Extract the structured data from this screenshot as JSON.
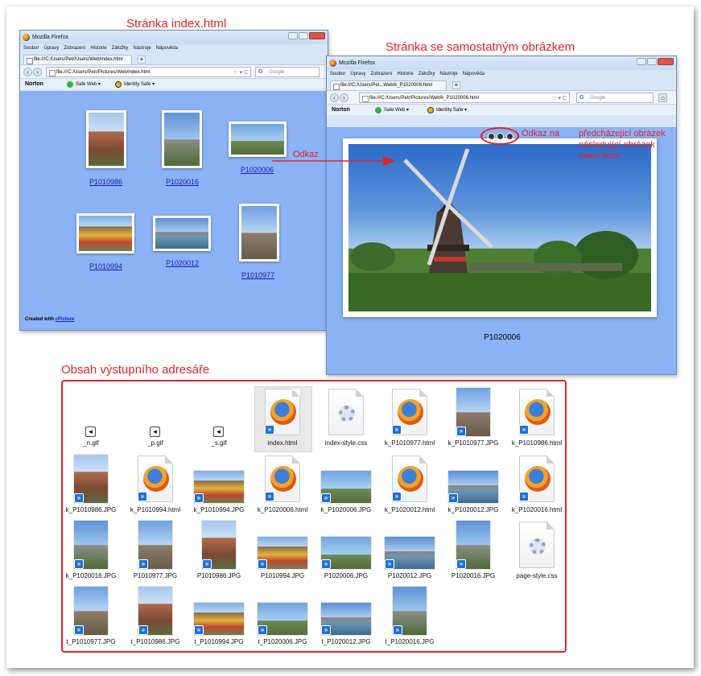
{
  "captions": {
    "index_page": "Stránka index.html",
    "single_page": "Stránka se samostatným obrázkem",
    "output_dir": "Obsah výstupního adresáře",
    "link": "Odkaz",
    "links_to": "Odkaz na",
    "link_targets": [
      "předcházející obrázek",
      "následující obrázek",
      "index.html"
    ]
  },
  "browser": {
    "title": "Mozilla Firefox",
    "menu": [
      "Soubor",
      "Úpravy",
      "Zobrazení",
      "Historie",
      "Záložky",
      "Nástroje",
      "Nápověda"
    ],
    "search_placeholder": "Google",
    "norton": "Norton",
    "safe_web": "Safe Web",
    "identity_safe": "Identity Safe"
  },
  "window1": {
    "tab_title": "file:///C:/Users/Petr/Users/Web/index.html",
    "url": "file:///C:/Users/Petr/Pictures/Web/index.html",
    "thumbs": [
      "P1010986",
      "P1020016",
      "P1020006",
      "P1010994",
      "P1020012",
      "P1010977"
    ],
    "footer_prefix": "Created with",
    "footer_link": "cPicture"
  },
  "window2": {
    "tab_title": "file:///C:/Users/Pet...Web/k_P1020006.html",
    "url": "file:///C:/Users/Petr/Pictures/Web/k_P1020006.html",
    "photo_caption": "P1020006"
  },
  "files": [
    {
      "name": "_n.gif",
      "kind": "gif",
      "glyph": "◂"
    },
    {
      "name": "_p.gif",
      "kind": "gif",
      "glyph": "◂"
    },
    {
      "name": "_s.gif",
      "kind": "gif",
      "glyph": "◂"
    },
    {
      "name": "index.html",
      "kind": "html",
      "selected": true
    },
    {
      "name": "index-style.css",
      "kind": "css"
    },
    {
      "name": "k_P1010977.html",
      "kind": "html"
    },
    {
      "name": "k_P1010977.JPG",
      "kind": "photo",
      "scene": "church",
      "orient": "p"
    },
    {
      "name": "k_P1010986.html",
      "kind": "html"
    },
    {
      "name": "k_P1010986.JPG",
      "kind": "photo",
      "scene": "brick",
      "orient": "p"
    },
    {
      "name": "k_P1010994.html",
      "kind": "html"
    },
    {
      "name": "k_P1010994.JPG",
      "kind": "photo",
      "scene": "cart",
      "orient": "l"
    },
    {
      "name": "k_P1020006.html",
      "kind": "html"
    },
    {
      "name": "k_P1020006.JPG",
      "kind": "photo",
      "scene": "sky",
      "orient": "l"
    },
    {
      "name": "k_P1020012.html",
      "kind": "html"
    },
    {
      "name": "k_P1020012.JPG",
      "kind": "photo",
      "scene": "canal",
      "orient": "l"
    },
    {
      "name": "k_P1020016.html",
      "kind": "html"
    },
    {
      "name": "k_P1020016.JPG",
      "kind": "photo",
      "scene": "sky2",
      "orient": "p"
    },
    {
      "name": "P1010977.JPG",
      "kind": "photo",
      "scene": "church",
      "orient": "p"
    },
    {
      "name": "P1010986.JPG",
      "kind": "photo",
      "scene": "brick",
      "orient": "p"
    },
    {
      "name": "P1010994.JPG",
      "kind": "photo",
      "scene": "cart",
      "orient": "l"
    },
    {
      "name": "P1020006.JPG",
      "kind": "photo",
      "scene": "sky",
      "orient": "l"
    },
    {
      "name": "P1020012.JPG",
      "kind": "photo",
      "scene": "canal",
      "orient": "l"
    },
    {
      "name": "P1020016.JPG",
      "kind": "photo",
      "scene": "sky2",
      "orient": "p"
    },
    {
      "name": "page-style.css",
      "kind": "css"
    },
    {
      "name": "t_P1010977.JPG",
      "kind": "photo",
      "scene": "church",
      "orient": "p"
    },
    {
      "name": "t_P1010986.JPG",
      "kind": "photo",
      "scene": "brick",
      "orient": "p"
    },
    {
      "name": "t_P1010994.JPG",
      "kind": "photo",
      "scene": "cart",
      "orient": "l"
    },
    {
      "name": "t_P1020006.JPG",
      "kind": "photo",
      "scene": "sky",
      "orient": "l"
    },
    {
      "name": "t_P1020012.JPG",
      "kind": "photo",
      "scene": "canal",
      "orient": "l"
    },
    {
      "name": "t_P1020016.JPG",
      "kind": "photo",
      "scene": "sky2",
      "orient": "p"
    }
  ]
}
